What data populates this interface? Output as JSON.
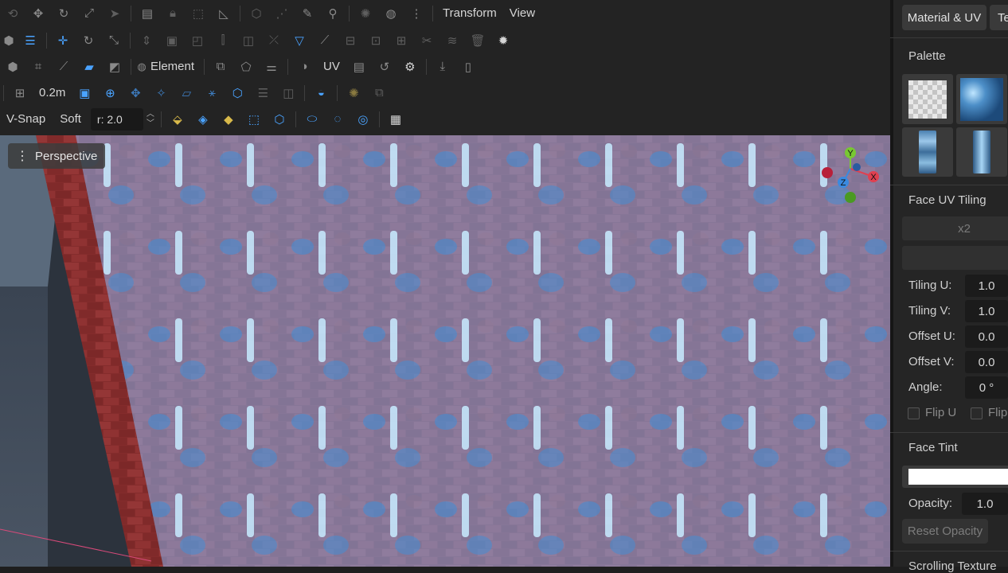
{
  "menu": {
    "transform": "Transform",
    "view": "View"
  },
  "toolbar": {
    "element_label": "Element",
    "uv_label": "UV",
    "grid_size": "0.2m",
    "vsnap_label": "V-Snap",
    "soft_label": "Soft",
    "radius_value": "r: 2.0"
  },
  "viewport": {
    "mode_label": "Perspective",
    "gizmo": {
      "y": "Y",
      "x": "X",
      "z": "Z"
    }
  },
  "panel": {
    "tab_material": "Material & UV",
    "tab_te": "Te",
    "palette_title": "Palette",
    "face_uv_tiling_title": "Face UV Tiling",
    "x2_button": "x2",
    "tiling_u_label": "Tiling U:",
    "tiling_u_value": "1.0",
    "tiling_v_label": "Tiling V:",
    "tiling_v_value": "1.0",
    "offset_u_label": "Offset U:",
    "offset_u_value": "0.0",
    "offset_v_label": "Offset V:",
    "offset_v_value": "0.0",
    "angle_label": "Angle:",
    "angle_value": "0 °",
    "flip_u_label": "Flip U",
    "flip_v_label": "Flip",
    "face_tint_title": "Face Tint",
    "opacity_label": "Opacity:",
    "opacity_value": "1.0",
    "reset_opacity_button": "Reset Opacity",
    "next_section_title": "Scrolling Texture"
  },
  "colors": {
    "accent": "#4aa3ff",
    "brick": "#b03a3a",
    "glow": "#6cc0ff"
  }
}
